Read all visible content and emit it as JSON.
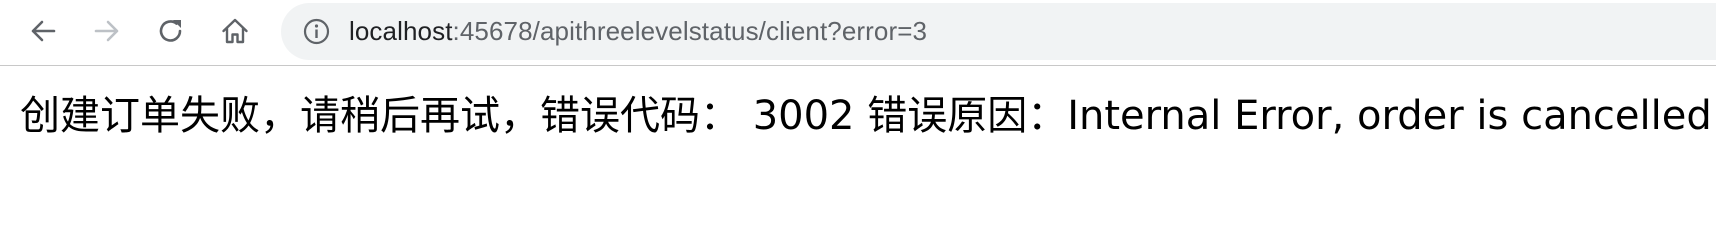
{
  "browser": {
    "url_host": "localhost",
    "url_rest": ":45678/apithreelevelstatus/client?error=3",
    "icons": {
      "back": "back-arrow-icon",
      "forward": "forward-arrow-icon",
      "reload": "reload-icon",
      "home": "home-icon",
      "site_info": "info-icon"
    },
    "colors": {
      "icon_active": "#5f6368",
      "icon_disabled": "#bdc1c6",
      "omnibox_bg": "#f1f3f4"
    }
  },
  "page": {
    "message": "创建订单失败，请稍后再试，错误代码： 3002 错误原因：Internal Error, order is cancelled"
  }
}
